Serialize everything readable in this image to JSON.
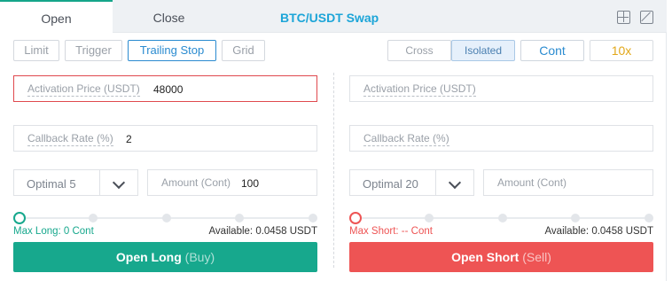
{
  "colors": {
    "accent": "#1ca5d8",
    "long": "#17a88d",
    "short": "#ee5454",
    "leverage": "#e2a81a",
    "link": "#2a8bd0"
  },
  "tabs": {
    "open": "Open",
    "close": "Close"
  },
  "title": "BTC/USDT Swap",
  "icons": {
    "calculator": "calculator-icon",
    "percent": "percent-icon"
  },
  "order_types": [
    "Limit",
    "Trigger",
    "Trailing Stop",
    "Grid"
  ],
  "active_order_type": "Trailing Stop",
  "margin": {
    "cross": "Cross",
    "isolated": "Isolated",
    "unit": "Cont",
    "leverage": "10x"
  },
  "long": {
    "activation": {
      "label": "Activation Price (USDT)",
      "value": "48000"
    },
    "callback": {
      "label": "Callback Rate (%)",
      "value": "2"
    },
    "optimal": "Optimal 5",
    "amount": {
      "label": "Amount (Cont)",
      "value": "100"
    },
    "slider_level": 0,
    "max": "Max Long: 0 Cont",
    "available": "Available: 0.0458 USDT",
    "button": {
      "main": "Open Long",
      "sub": "(Buy)"
    }
  },
  "short": {
    "activation": {
      "label": "Activation Price (USDT)",
      "value": ""
    },
    "callback": {
      "label": "Callback Rate (%)",
      "value": ""
    },
    "optimal": "Optimal 20",
    "amount": {
      "label": "Amount (Cont)",
      "value": ""
    },
    "slider_level": 0,
    "max": "Max Short: -- Cont",
    "available": "Available: 0.0458 USDT",
    "button": {
      "main": "Open Short",
      "sub": "(Sell)"
    }
  }
}
